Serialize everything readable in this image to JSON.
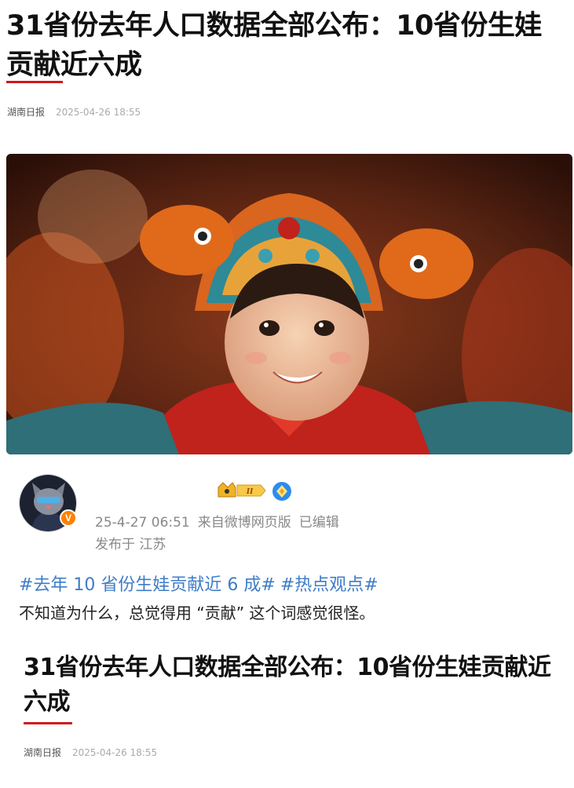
{
  "article": {
    "headline": "31省份去年人口数据全部公布：10省份生娃贡献近六成",
    "source": "湖南日报",
    "date": "2025-04-26 18:55"
  },
  "post": {
    "time": "25-4-27 06:51",
    "via": "来自微博网页版",
    "edited": "已编辑",
    "location": "发布于 江苏",
    "topics": [
      "#去年 10 省份生娃贡献近 6 成#",
      "#热点观点#"
    ],
    "text": "不知道为什么，总觉得用 “贡献” 这个词感觉很怪。",
    "verified_badge": "V",
    "crown_level": "II"
  },
  "quoted": {
    "headline": "31省份去年人口数据全部公布：10省份生娃贡献近六成",
    "source": "湖南日报",
    "date": "2025-04-26 18:55"
  },
  "colors": {
    "accent_red": "#d0181b",
    "topic_blue": "#3f7cc7",
    "badge_orange": "#ff8200",
    "meta_gray": "#888888"
  },
  "icons": [
    "crown-badge-icon",
    "blue-diamond-badge-icon",
    "verified-v-icon"
  ]
}
